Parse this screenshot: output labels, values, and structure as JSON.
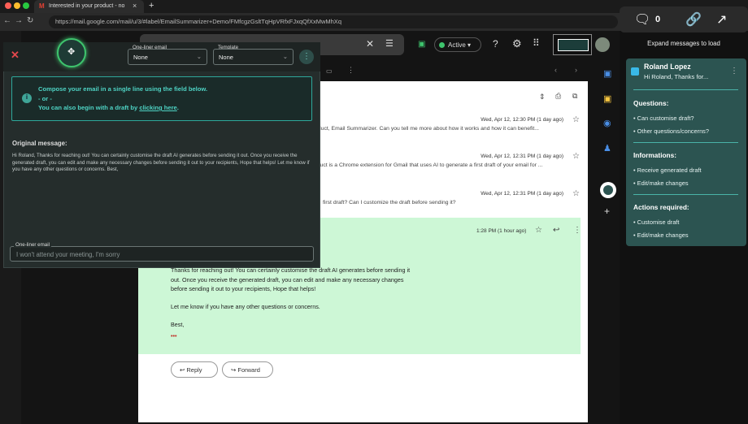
{
  "browser": {
    "tab_title": "Interested in your product - no",
    "tab_close": "×",
    "new_tab": "+",
    "url": "https://mail.google.com/mail/u/3/#label/EmailSummarizer+Demo/FMfcgzGsltTqHpVRfxFJxqQfXxMwMhXq"
  },
  "gmail": {
    "status": "Active",
    "messages": [
      {
        "date": "Wed, Apr 12, 12:30 PM (1 day ago)",
        "snippet": "your product, Email Summarizer. Can you tell me more about how it works and how it can benefit..."
      },
      {
        "date": "Wed, Apr 12, 12:31 PM (1 day ago)",
        "snippet": "ur product is a Chrome extension for Gmail that uses AI to generate a first draft of your email for ..."
      },
      {
        "date": "Wed, Apr 12, 12:31 PM (1 day ago)",
        "snippet": "first draft? Can I customize the draft before sending it?"
      }
    ],
    "open_message": {
      "time": "1:28 PM (1 hour ago)",
      "para1_line1": "Thanks for reaching out! You can certainly customise the draft AI generates before sending it",
      "para1_line2": "out. Once you receive the generated draft, you can edit and make any necessary changes",
      "para1_line3": "before sending it out to your recipients, Hope that helps!",
      "para2": "Let me know if you have any other questions or concerns.",
      "sign": "Best,",
      "more": "•••"
    },
    "reply_label": "Reply",
    "forward_label": "Forward"
  },
  "compose": {
    "oneliner_select_label": "One-liner email",
    "oneliner_select_value": "None",
    "template_label": "Template",
    "template_value": "None",
    "info_line1": "Compose your email in a single line using the field below.",
    "info_line2": "- or -",
    "info_line3_prefix": "You can also begin with a draft by ",
    "info_link": "clicking here",
    "info_line3_suffix": ".",
    "original_label": "Original message:",
    "original_text": "Hi Roland, Thanks for reaching out! You can certainly customise the draft AI generates before sending it out. Once you receive the generated draft, you can edit and make any necessary changes before sending it out to your recipients, Hope that helps! Let me know if you have any other questions or concerns. Best,",
    "oneliner_field_label": "One-liner email",
    "oneliner_placeholder": "I won't attend your meeting, I'm sorry"
  },
  "panel": {
    "comment_count": "0",
    "expand_text": "Expand messages to load",
    "sender": "Roland Lopez",
    "preview": "Hi Roland, Thanks for...",
    "questions_h": "Questions:",
    "questions": [
      "Can customise draft?",
      "Other questions/concerns?"
    ],
    "info_h": "Informations:",
    "info": [
      "Receive generated draft",
      "Edit/make changes"
    ],
    "actions_h": "Actions required:",
    "actions": [
      "Customise draft",
      "Edit/make changes"
    ]
  },
  "colors": {
    "accent": "#4ed3c4",
    "card": "#2c5451",
    "green_msg": "#cdf7d6"
  }
}
